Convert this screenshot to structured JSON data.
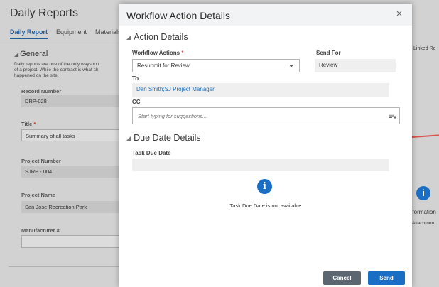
{
  "background": {
    "title": "Daily Reports",
    "tabs": [
      "Daily Report",
      "Equipment",
      "Materials"
    ],
    "section_title": "General",
    "description": "Daily reports are one of the only ways to t\nof a project. While the contract is what sh\nhappened on the site.",
    "fields": [
      {
        "label": "Record Number",
        "value": "DRP-028",
        "required": false
      },
      {
        "label": "Title",
        "value": "Summary of all tasks",
        "required": true
      },
      {
        "label": "Project Number",
        "value": "SJRP - 004",
        "required": false
      },
      {
        "label": "Project Name",
        "value": "San Jose Recreation Park",
        "required": false
      },
      {
        "label": "Manufacturer #",
        "value": "",
        "required": false
      }
    ],
    "right_linked": "Linked Re",
    "right_info_text": "nformation",
    "right_attach_text": "Attachmen"
  },
  "modal": {
    "title": "Workflow Action Details",
    "action_section": "Action Details",
    "workflow_actions_label": "Workflow Actions",
    "workflow_actions_value": "Resubmit for Review",
    "send_for_label": "Send For",
    "send_for_value": "Review",
    "to_label": "To",
    "to_value": "Dan Smith;SJ Project Manager",
    "cc_label": "CC",
    "cc_placeholder": "Start typing for suggestions...",
    "due_section": "Due Date Details",
    "task_due_label": "Task Due Date",
    "task_due_value": "",
    "info_message": "Task Due Date is not available",
    "cancel_label": "Cancel",
    "send_label": "Send",
    "close_symbol": "×",
    "info_symbol": "i",
    "required_marker": "*",
    "collapse_symbol": "◢"
  },
  "colors": {
    "accent": "#1a6fc4",
    "cancel": "#5c6670",
    "required": "#d0021b",
    "annotation_arrow": "#d9534f"
  },
  "icons": [
    "close-icon",
    "collapse-triangle-icon",
    "chevron-down-icon",
    "contact-picker-icon",
    "info-icon"
  ]
}
